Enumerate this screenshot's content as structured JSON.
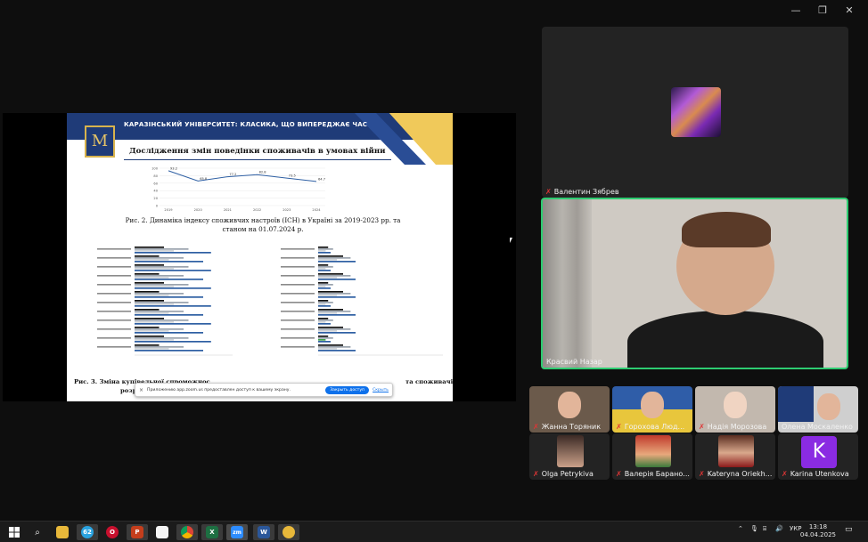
{
  "window": {
    "minimize": "—",
    "restore": "❐",
    "close": "✕"
  },
  "slide": {
    "university": "КАРАЗІНСЬКИЙ УНІВЕРСИТЕТ: КЛАСИКА, ЩО ВИПЕРЕДЖАЄ ЧАС",
    "logo_letter": "M",
    "title": "Дослідження змін поведінки споживачів в умовах війни",
    "fig2_caption": "Рис. 2. Динаміка індексу споживчих настроїв (ІСН) в Україні за 2019-2023 рр. та станом на 01.07.2024 р.",
    "fig3_caption_left": "Рис. 3. Зміна купівельної спроможнос",
    "fig3_caption_right": "та споживачів",
    "fig3_caption_bottom": "розрізі сегментів, (%)"
  },
  "notification": {
    "text": "Приложению app.zoom.us предоставлен доступ к вашему экрану.",
    "primary": "Закрыть доступ",
    "secondary": "Скрыть"
  },
  "participants": {
    "speaker_top": "Валентин Зябрев",
    "speaker_main": "Красвий Назар",
    "grid": [
      "Жанна Торяник",
      "Горохова Люд...",
      "Надія Морозова",
      "Олена Москаленко",
      "Olga Petrykiva",
      "Валерія Барано...",
      "Kateryna Oriekh...",
      "Karina Utenkova"
    ],
    "k_letter": "K"
  },
  "taskbar": {
    "lang": "УКР",
    "time": "13:18",
    "date": "04.04.2025",
    "tg_badge": "62"
  },
  "colors": {
    "slide_blue": "#1f3b78",
    "slide_gold": "#f0c95a",
    "active_speaker": "#2ecc71",
    "zoom_blue": "#0e71eb"
  },
  "chart_data": [
    {
      "type": "line",
      "x": [
        "2019",
        "2020",
        "2021",
        "2022",
        "2023",
        "2024"
      ],
      "values": [
        93.2,
        65.8,
        77.2,
        82.8,
        73.5,
        64.7
      ],
      "ylim": [
        0,
        100
      ],
      "yticks": [
        0,
        20,
        40,
        60,
        80,
        100
      ]
    }
  ]
}
